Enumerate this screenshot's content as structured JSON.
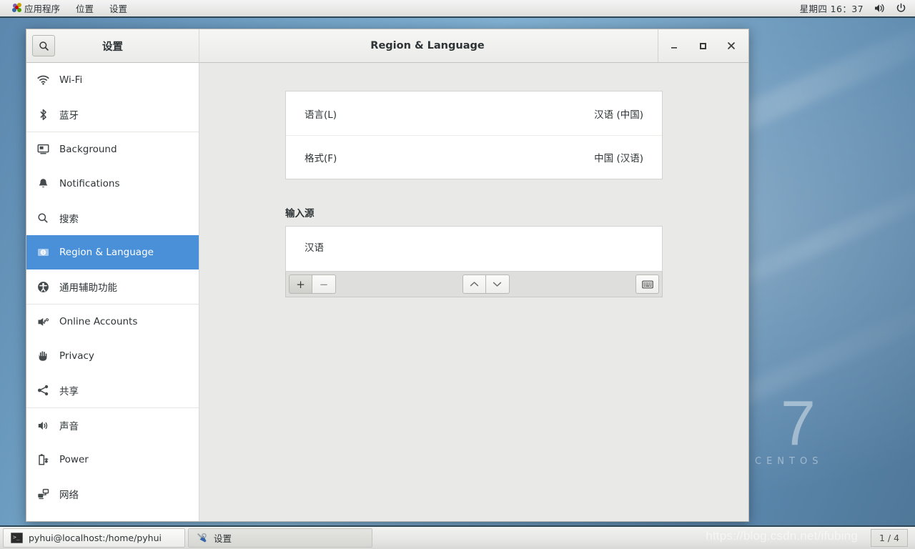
{
  "top_panel": {
    "menu_items": [
      {
        "label": "应用程序",
        "icon": "gnome-foot-icon"
      },
      {
        "label": "位置",
        "icon": ""
      },
      {
        "label": "设置",
        "icon": ""
      }
    ],
    "clock": "星期四 16：37",
    "tray": [
      {
        "name": "volume-icon"
      },
      {
        "name": "power-icon"
      }
    ]
  },
  "window": {
    "title": "Region & Language",
    "sidebar_title": "设置",
    "search_icon": "search-icon",
    "controls": {
      "minimize": "–",
      "maximize": "□",
      "close": "✕"
    }
  },
  "sidebar": {
    "items": [
      {
        "label": "Wi-Fi",
        "icon": "wifi-icon",
        "selected": false
      },
      {
        "label": "蓝牙",
        "icon": "bluetooth-icon",
        "selected": false
      },
      {
        "label": "Background",
        "icon": "background-icon",
        "selected": false,
        "separator_before": true
      },
      {
        "label": "Notifications",
        "icon": "bell-icon",
        "selected": false
      },
      {
        "label": "搜索",
        "icon": "search-icon",
        "selected": false
      },
      {
        "label": "Region & Language",
        "icon": "region-language-icon",
        "selected": true
      },
      {
        "label": "通用辅助功能",
        "icon": "accessibility-icon",
        "selected": false
      },
      {
        "label": "Online Accounts",
        "icon": "online-accounts-icon",
        "selected": false,
        "separator_before": true
      },
      {
        "label": "Privacy",
        "icon": "privacy-hand-icon",
        "selected": false
      },
      {
        "label": "共享",
        "icon": "sharing-icon",
        "selected": false
      },
      {
        "label": "声音",
        "icon": "sound-icon",
        "selected": false,
        "separator_before": true
      },
      {
        "label": "Power",
        "icon": "power-battery-icon",
        "selected": false
      },
      {
        "label": "网络",
        "icon": "network-icon",
        "selected": false
      }
    ]
  },
  "main": {
    "rows": [
      {
        "label": "语言(L)",
        "value": "汉语 (中国)"
      },
      {
        "label": "格式(F)",
        "value": "中国 (汉语)"
      }
    ],
    "input_sources": {
      "title": "输入源",
      "items": [
        "汉语"
      ],
      "toolbar": {
        "add": "+",
        "remove": "−",
        "move_up": "⌃",
        "move_down": "⌄",
        "keyboard": "keyboard-icon"
      }
    }
  },
  "desktop": {
    "logo_number": "7",
    "logo_word": "CENTOS"
  },
  "taskbar": {
    "tasks": [
      {
        "label": "pyhui@localhost:/home/pyhui",
        "icon": "terminal-icon",
        "active": false
      },
      {
        "label": "设置",
        "icon": "tools-icon",
        "active": true
      }
    ],
    "workspace": "1 / 4",
    "watermark": "https://blog.csdn.net/ifubing"
  },
  "colors": {
    "selection_blue": "#4a90d9",
    "panel_border": "#2e4756",
    "content_bg": "#e9e9e7"
  }
}
